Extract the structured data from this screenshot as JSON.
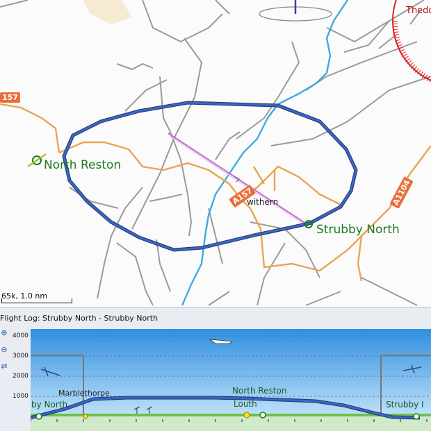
{
  "map": {
    "labels": {
      "north_reston": "North Reston",
      "strubby_north": "Strubby North",
      "withern": "withern",
      "theddlethorpe": "Thedd"
    },
    "roads": {
      "a157_left": "157",
      "a157_center": "A157",
      "a1104": "A1104"
    },
    "scale": "65k, 1.0 nm",
    "colors": {
      "task_route": "#3a66c4",
      "minor_road": "#e8a550",
      "stream": "#3fa9df",
      "lane": "#9a9a9a",
      "restricted": "#e02020"
    }
  },
  "flight_log": {
    "title": "Flight Log: Strubby North - Strubby North",
    "y_ticks": [
      "4000",
      "3000",
      "2000",
      "1000"
    ],
    "profile_labels": {
      "start": "by North",
      "marblethorpe": "Marblethorpe",
      "north_reston": "North Reston",
      "louth": "Louth",
      "finish": "Strubby I"
    },
    "tools": [
      "zoom-in-icon",
      "zoom-out-icon",
      "pan-icon"
    ]
  }
}
